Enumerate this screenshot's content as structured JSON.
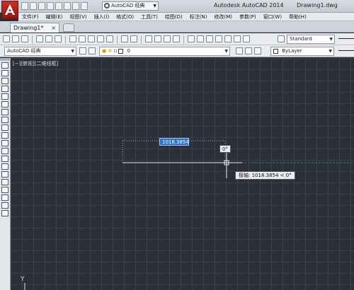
{
  "title": {
    "workspace": "AutoCAD 经典",
    "app": "Autodesk AutoCAD 2014",
    "document": "Drawing1.dwg"
  },
  "menu": [
    "文件(F)",
    "编辑(E)",
    "视图(V)",
    "插入(I)",
    "格式(O)",
    "工具(T)",
    "绘图(D)",
    "标注(N)",
    "修改(M)",
    "参数(P)",
    "窗口(W)",
    "帮助(H)"
  ],
  "tabs": {
    "active": "Drawing1*",
    "close": "×"
  },
  "toolbar": {
    "text_style": "Standard",
    "workspace": "AutoCAD 经典",
    "layer": "0",
    "color": "ByLayer"
  },
  "canvas": {
    "viewport_label": "[−][俯视][二维线框]",
    "dimension_value": "1018.3854",
    "angle_tip": "0°",
    "polar_tip": "极轴: 1018.3854 < 0°",
    "ucs_axis": "Y"
  },
  "colors": {
    "canvas_bg": "#2b2f3a",
    "grid": "#3a3f4b",
    "accent_input": "#2f73c4",
    "polar_track": "#2e8b3d",
    "drawn_line": "#dfe3e8"
  }
}
